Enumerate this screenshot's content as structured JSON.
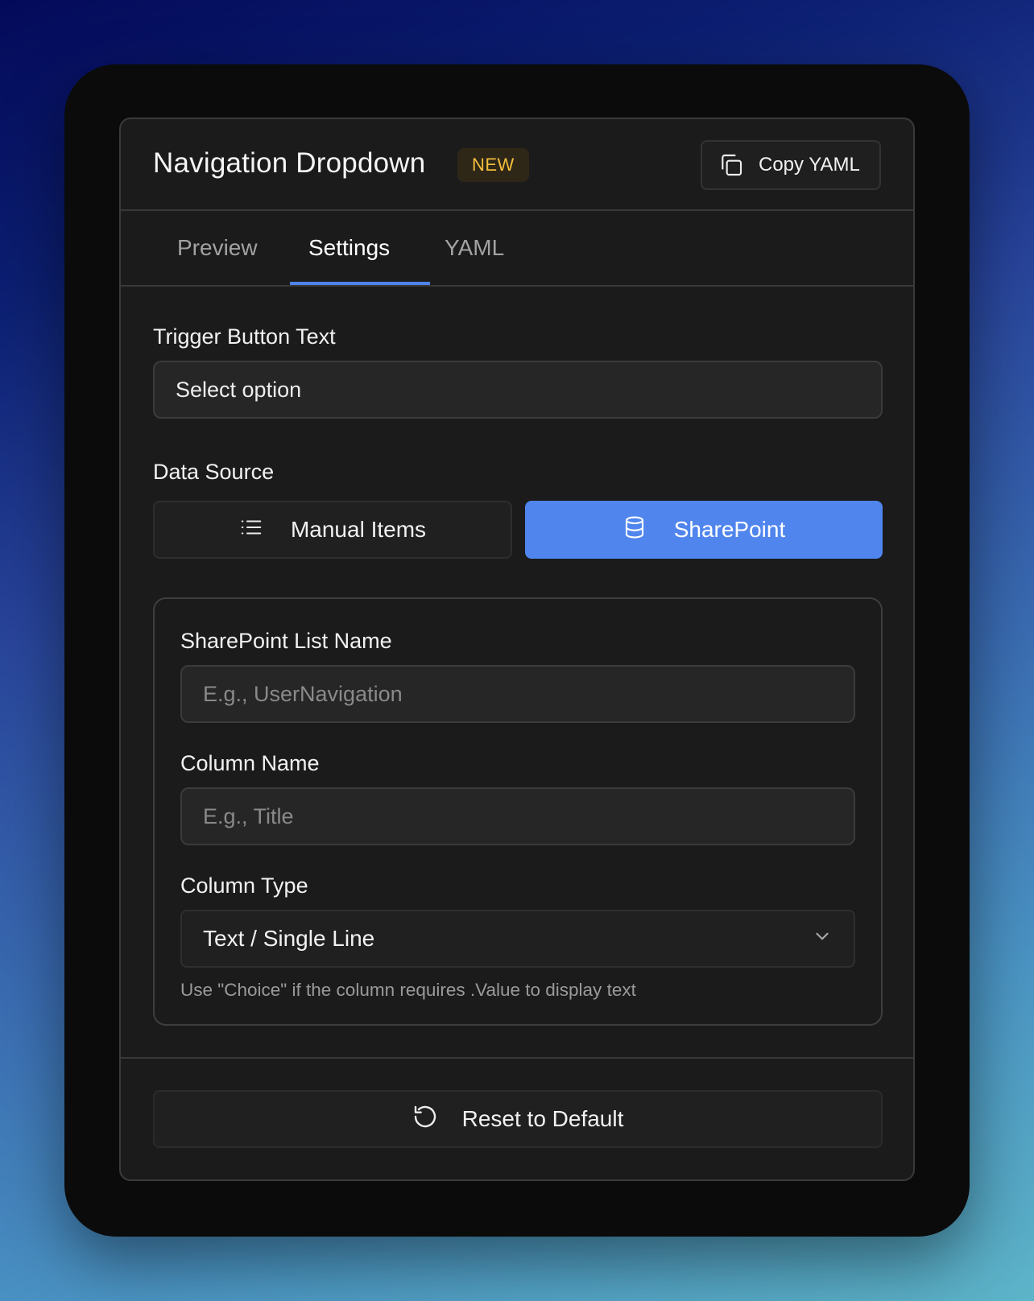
{
  "header": {
    "title": "Navigation Dropdown",
    "badge": "NEW",
    "copy_label": "Copy YAML"
  },
  "tabs": [
    {
      "label": "Preview",
      "active": false
    },
    {
      "label": "Settings",
      "active": true
    },
    {
      "label": "YAML",
      "active": false
    }
  ],
  "trigger": {
    "label": "Trigger Button Text",
    "value": "Select option"
  },
  "data_source": {
    "label": "Data Source",
    "options": [
      {
        "label": "Manual Items",
        "icon": "list-icon",
        "selected": false
      },
      {
        "label": "SharePoint",
        "icon": "database-icon",
        "selected": true
      }
    ]
  },
  "sharepoint": {
    "list_name_label": "SharePoint List Name",
    "list_name_placeholder": "E.g., UserNavigation",
    "column_name_label": "Column Name",
    "column_name_placeholder": "E.g., Title",
    "column_type_label": "Column Type",
    "column_type_value": "Text / Single Line",
    "hint": "Use \"Choice\" if the column requires .Value to display text"
  },
  "footer": {
    "reset_label": "Reset to Default"
  },
  "colors": {
    "accent": "#5085ee",
    "badge_text": "#f2be3c",
    "badge_bg": "#2e2717"
  }
}
